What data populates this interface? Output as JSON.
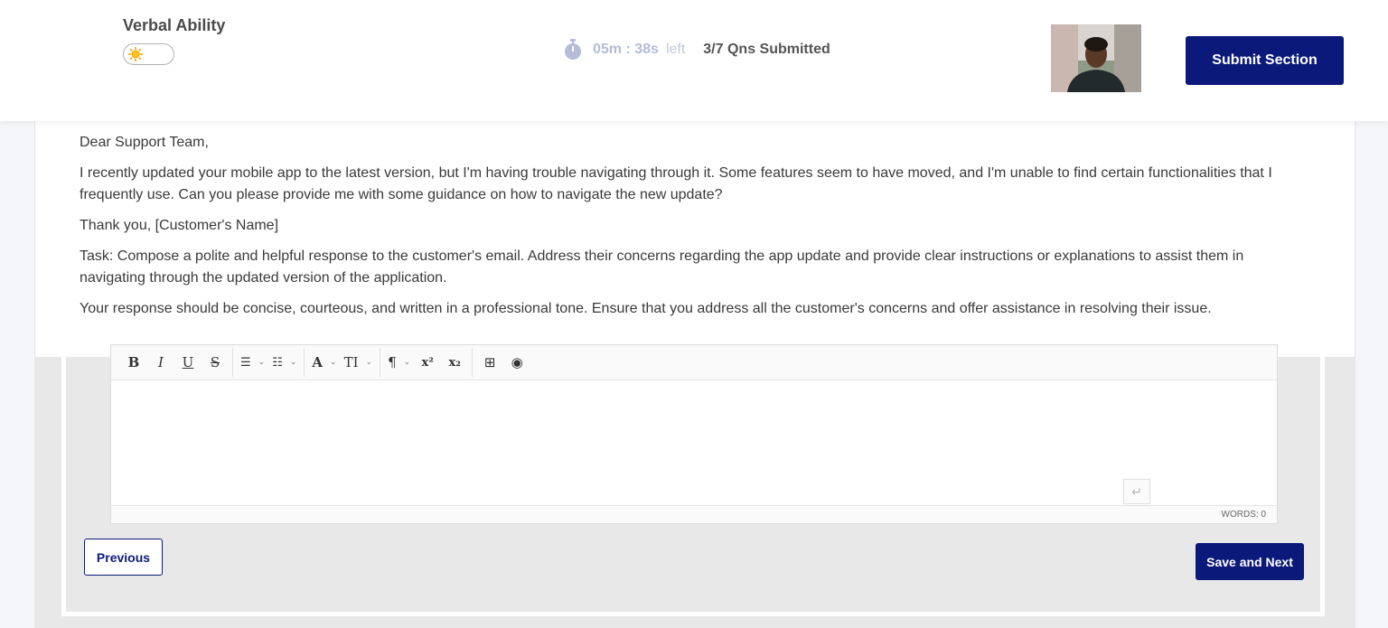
{
  "header": {
    "section_title": "Verbal Ability",
    "timer_value": "05m : 38s",
    "timer_suffix": "left",
    "submitted_status": "3/7 Qns Submitted",
    "submit_section_label": "Submit Section"
  },
  "question": {
    "paragraphs": [
      "Dear Support Team,",
      "I recently updated your mobile app to the latest version, but I'm having trouble navigating through it. Some features seem to have moved, and I'm unable to find certain functionalities that I frequently use. Can you please provide me with some guidance on how to navigate the new update?",
      "Thank you, [Customer's Name]",
      "Task: Compose a polite and helpful response to the customer's email. Address their concerns regarding the app update and provide clear instructions or explanations to assist them in navigating through the updated version of the application.",
      "Your response should be concise, courteous, and written in a professional tone. Ensure that you address all the customer's concerns and offer assistance in resolving their issue."
    ]
  },
  "editor": {
    "content": "",
    "word_count": "WORDS: 0",
    "toolbar": {
      "bold": "B",
      "italic": "I",
      "underline": "U",
      "strikethrough": "S",
      "unordered_list": "☰",
      "ordered_list": "☷",
      "font_color": "A",
      "font_size": "TI",
      "paragraph": "¶",
      "superscript": "x²",
      "subscript": "x₂",
      "table": "⊞",
      "preview": "◉"
    }
  },
  "footer": {
    "previous_label": "Previous",
    "save_next_label": "Save and Next"
  },
  "colors": {
    "primary": "#0b1a7a",
    "timer": "#b4bcd8",
    "background": "#f5f6fa",
    "grey_area": "#e8e8e8"
  },
  "icons": {
    "theme_toggle": "sun-icon",
    "timer": "stopwatch-icon",
    "enter": "enter-icon"
  }
}
